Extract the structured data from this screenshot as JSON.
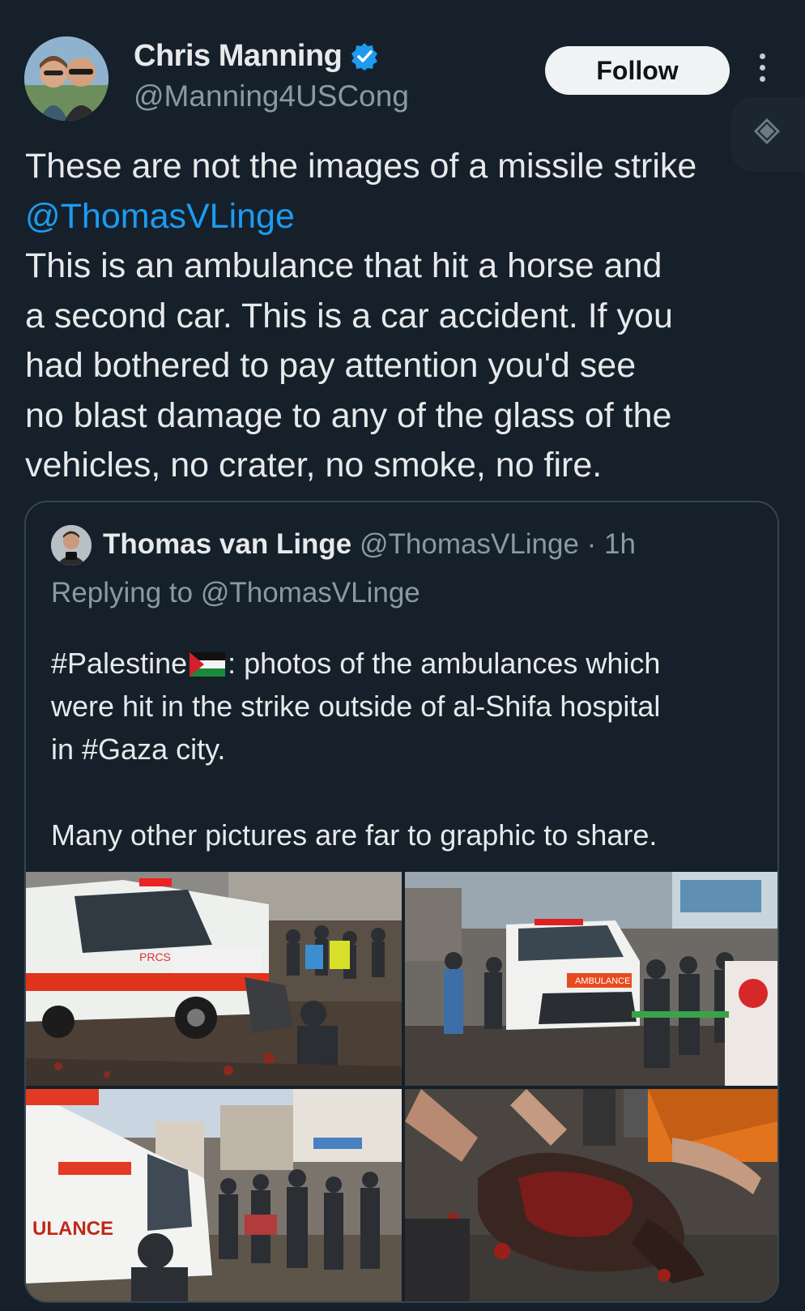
{
  "author": {
    "name": "Chris Manning",
    "handle": "@Manning4USCong",
    "verified": true,
    "avatar_icon": "couple-selfie-avatar"
  },
  "actions": {
    "follow_label": "Follow",
    "more_icon": "more-vertical-icon"
  },
  "tweet": {
    "line1": "These are not the images of a missile strike",
    "mention": "@ThomasVLinge",
    "line3": "This is an ambulance that hit a horse and",
    "line4": "a second car. This is a car accident. If you",
    "line5": "had bothered to pay attention you'd see",
    "line6": "no blast damage to any of the glass of the",
    "line7": "vehicles, no crater, no smoke, no fire."
  },
  "quoted": {
    "name": "Thomas van Linge",
    "meta": "@ThomasVLinge · 1h",
    "replying": "Replying to @ThomasVLinge",
    "text_a1": "#Palestine",
    "text_a2": ": photos of the ambulances which",
    "text_a3": "were hit in the strike outside of al-Shifa hospital",
    "text_a4": "in #Gaza city.",
    "text_b": "Many other pictures are far to graphic to share.",
    "flag_icon": "palestine-flag-icon",
    "photos": [
      {
        "icon": "ambulance-photo",
        "label": "PRCS"
      },
      {
        "icon": "ambulance-front-photo",
        "label": "AMBULANCE"
      },
      {
        "icon": "ambulance-side-photo",
        "label": "ULANCE"
      },
      {
        "icon": "horse-photo",
        "label": ""
      }
    ]
  },
  "colors": {
    "background": "#15202b",
    "text": "#e7e9ea",
    "secondary": "#8b98a5",
    "link": "#1d9bf0",
    "border": "#38444d"
  }
}
